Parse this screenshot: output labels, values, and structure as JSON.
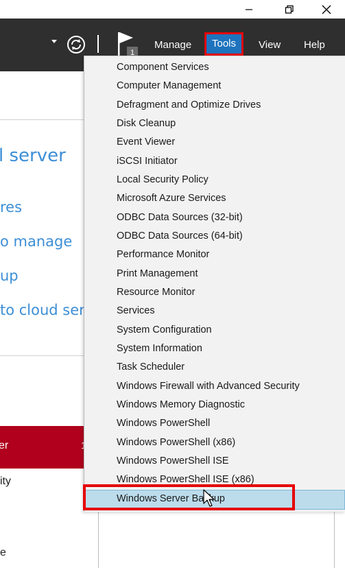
{
  "window": {
    "controls": {
      "minimize_icon": "minimize-icon",
      "maximize_icon": "restore-icon",
      "close_icon": "close-icon"
    }
  },
  "header": {
    "notification_count": "1",
    "menu": [
      "Manage",
      "Tools",
      "View",
      "Help"
    ],
    "selected_menu": "Tools"
  },
  "background": {
    "title_fragment": "l server",
    "links": [
      "res",
      "o manage",
      "up",
      "to cloud serv"
    ],
    "selected_item": "er",
    "selected_count": "1",
    "item_below": "ity",
    "item_bottom": "e"
  },
  "tools_menu": {
    "items": [
      "Component Services",
      "Computer Management",
      "Defragment and Optimize Drives",
      "Disk Cleanup",
      "Event Viewer",
      "iSCSI Initiator",
      "Local Security Policy",
      "Microsoft Azure Services",
      "ODBC Data Sources (32-bit)",
      "ODBC Data Sources (64-bit)",
      "Performance Monitor",
      "Print Management",
      "Resource Monitor",
      "Services",
      "System Configuration",
      "System Information",
      "Task Scheduler",
      "Windows Firewall with Advanced Security",
      "Windows Memory Diagnostic",
      "Windows PowerShell",
      "Windows PowerShell (x86)",
      "Windows PowerShell ISE",
      "Windows PowerShell ISE (x86)",
      "Windows Server Backup"
    ],
    "hovered_item": "Windows Server Backup"
  },
  "colors": {
    "header_bg": "#2f2f2f",
    "accent": "#1e73be",
    "highlight_red": "#e60000",
    "link_blue": "#3c8ed6",
    "hover_bg": "#bcdcec"
  }
}
